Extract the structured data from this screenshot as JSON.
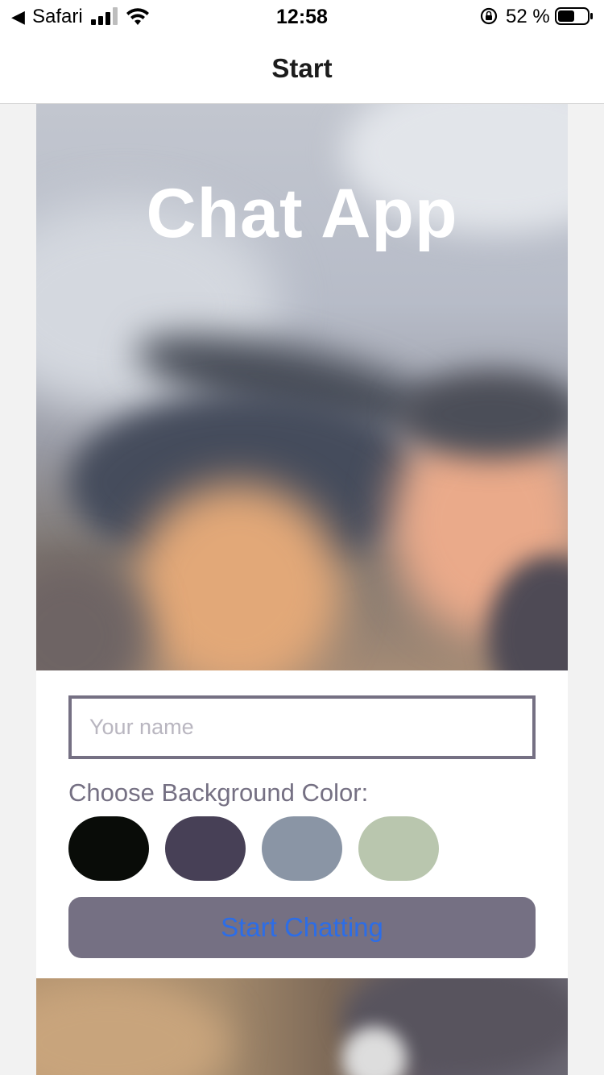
{
  "status_bar": {
    "back_icon": "back-triangle-icon",
    "back_app": "Safari",
    "time": "12:58",
    "battery_percent": "52 %"
  },
  "nav": {
    "title": "Start"
  },
  "hero": {
    "title": "Chat App"
  },
  "form": {
    "name_placeholder": "Your name",
    "name_value": "",
    "color_label": "Choose Background Color:",
    "colors": [
      "#090C08",
      "#474056",
      "#8A95A5",
      "#B9C6AE"
    ],
    "button_label": "Start Chatting",
    "button_color": "#757083",
    "button_text_color": "#2C6DE7"
  }
}
